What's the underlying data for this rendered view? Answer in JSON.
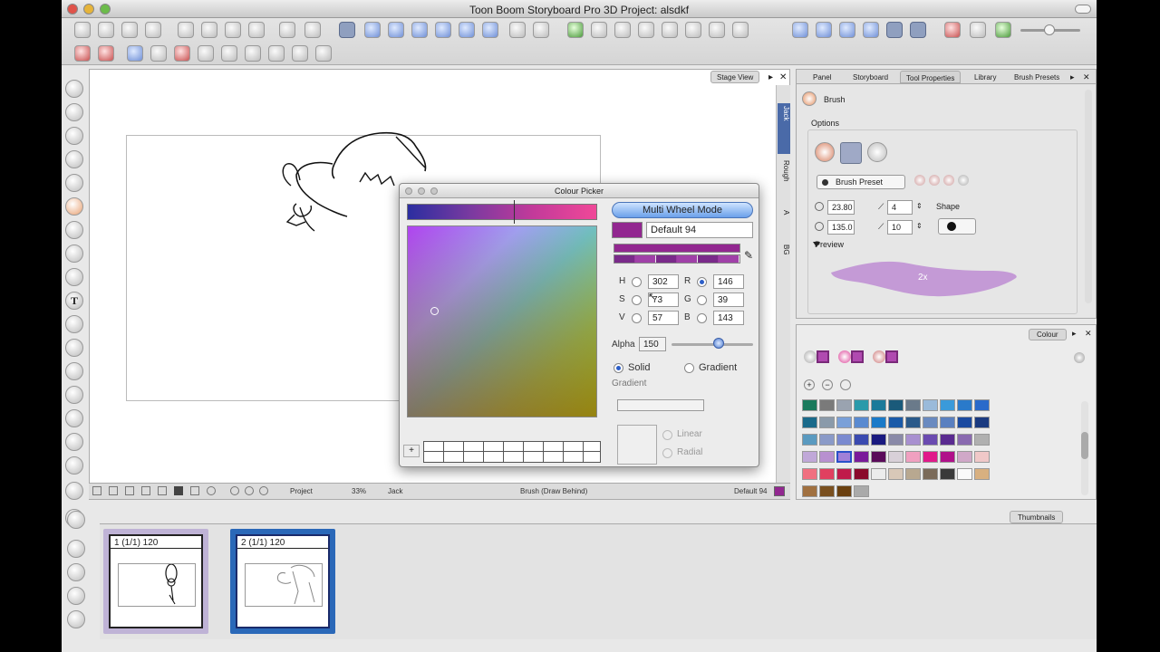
{
  "window": {
    "title": "Toon Boom Storyboard Pro 3D Project: alsdkf"
  },
  "stage": {
    "tab_label": "Stage View"
  },
  "vstrip": {
    "labels": [
      "Jack",
      "Rough",
      "A",
      "BG"
    ]
  },
  "statusbar": {
    "mode": "Project",
    "zoom": "33%",
    "layer": "Jack",
    "tool": "Brush (Draw Behind)",
    "colour_name": "Default 94"
  },
  "thumbnails": {
    "tab_label": "Thumbnails",
    "items": [
      {
        "caption": "1 (1/1) 120"
      },
      {
        "caption": "2 (1/1) 120"
      }
    ]
  },
  "right_panel": {
    "tabs": [
      "Panel",
      "Storyboard",
      "Tool Properties",
      "Library",
      "Brush Presets"
    ],
    "active_tab": "Tool Properties",
    "tool_name": "Brush",
    "options_label": "Options",
    "preset_label": "Brush Preset",
    "max_size": "23.80",
    "min_size": "135.0",
    "smoothing": "4",
    "thickness_smoothing": "10",
    "shape_label": "Shape",
    "preview_label": "Preview",
    "preview_badge": "2x"
  },
  "colour_panel": {
    "tab_label": "Colour",
    "swatches": [
      [
        "#1a7a5c",
        "#7a7a7a",
        "#9aa3b0",
        "#2a9aaa",
        "#1a7a9a",
        "#1a5a7a",
        "#6a7a8a",
        "#9abada",
        "#3a9ada",
        "#2a7aca",
        "#2a6aca"
      ],
      [
        "#1a6a8a",
        "#8a9aaa",
        "#7aa0d8",
        "#5a8ad0",
        "#1a7ac8",
        "#1a5aa8",
        "#2a5a8a",
        "#6a8ac0",
        "#5a80c0",
        "#1a4aa0",
        "#1a3a80"
      ],
      [
        "#5a9ac0",
        "#8a9ac8",
        "#7a8ad0",
        "#3a4ab0",
        "#1a1a80",
        "#8a8aa8",
        "#a890d0",
        "#6a4ab0",
        "#5a2a90",
        "#8a6ab0",
        "#b0b0b0"
      ],
      [
        "#c0a8d8",
        "#b890d0",
        "#a080d8",
        "#7a1a9a",
        "#5a0a5a",
        "#d8d0d8",
        "#f0a0c0",
        "#e01a8a",
        "#b0108a",
        "#d0a8c8",
        "#f0c8c8"
      ],
      [
        "#f07080",
        "#e04060",
        "#c01a4a",
        "#8a0a2a",
        "#ececec",
        "#d8c8b8",
        "#b8a890",
        "#7a6a5a",
        "#3a3a3a",
        "#fafafa",
        "#d8b080"
      ],
      [
        "#a07040",
        "#7a5020",
        "#6a4010",
        "#aaaaaa"
      ]
    ]
  },
  "colour_picker": {
    "title": "Colour Picker",
    "mode_button": "Multi Wheel Mode",
    "colour_name": "Default 94",
    "hsv": {
      "h": "302",
      "s": "73",
      "v": "57"
    },
    "rgb": {
      "r": "146",
      "g": "39",
      "b": "143"
    },
    "labels": {
      "h": "H",
      "s": "S",
      "v": "V",
      "r": "R",
      "g": "G",
      "b": "B"
    },
    "alpha_label": "Alpha",
    "alpha": "150",
    "solid_label": "Solid",
    "gradient_label": "Gradient",
    "gradient_section": "Gradient",
    "linear_label": "Linear",
    "radial_label": "Radial",
    "add_label": "+",
    "accent": "#922790"
  }
}
